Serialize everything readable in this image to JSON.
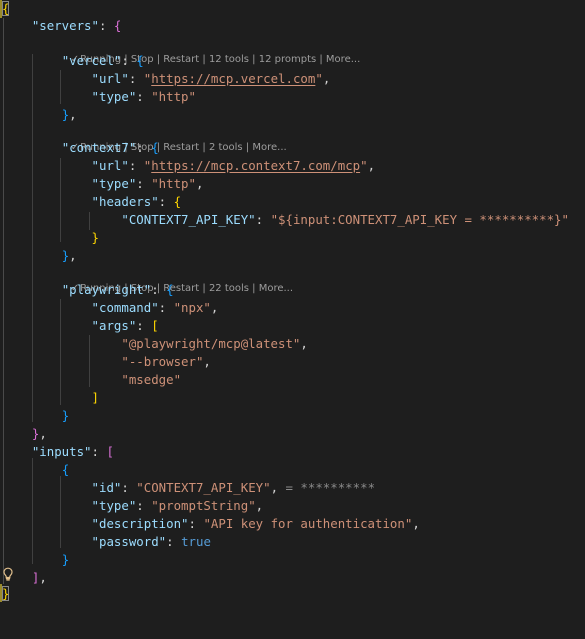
{
  "editor": {
    "lenses": {
      "servers": "Running | Stop | Restart | 12 tools | 12 prompts | More...",
      "context7": "Running | Stop | Restart | 2 tools | More...",
      "playwright": "Running | Stop | Restart | 22 tools | More..."
    },
    "keys": {
      "servers": "\"servers\"",
      "vercel": "\"vercel\"",
      "url": "\"url\"",
      "type": "\"type\"",
      "context7": "\"context7\"",
      "headers": "\"headers\"",
      "context7_api_key": "\"CONTEXT7_API_KEY\"",
      "playwright": "\"playwright\"",
      "command": "\"command\"",
      "args": "\"args\"",
      "inputs": "\"inputs\"",
      "id": "\"id\"",
      "description": "\"description\"",
      "password": "\"password\""
    },
    "values": {
      "vercel_url_q1": "\"",
      "vercel_url": "https://mcp.vercel.com",
      "vercel_url_q2": "\"",
      "http": "\"http\"",
      "context7_url_q1": "\"",
      "context7_url": "https://mcp.context7.com/mcp",
      "context7_url_q2": "\"",
      "api_key_value": "\"${input:CONTEXT7_API_KEY = **********}\"",
      "npx": "\"npx\"",
      "arg1": "\"@playwright/mcp@latest\"",
      "arg2": "\"--browser\"",
      "arg3": "\"msedge\"",
      "input_id": "\"CONTEXT7_API_KEY\"",
      "input_id_hint": " = **********",
      "prompt_string": "\"promptString\"",
      "description": "\"API key for authentication\"",
      "true": "true"
    },
    "lightbulb_icon": "lightbulb-icon",
    "colors": {
      "background": "#1e1e1e",
      "key": "#9cdcfe",
      "string": "#ce9178",
      "bracket_gold": "#ffd700",
      "bracket_purple": "#da70d6",
      "bracket_blue": "#179fff",
      "keyword": "#569cd6"
    }
  }
}
